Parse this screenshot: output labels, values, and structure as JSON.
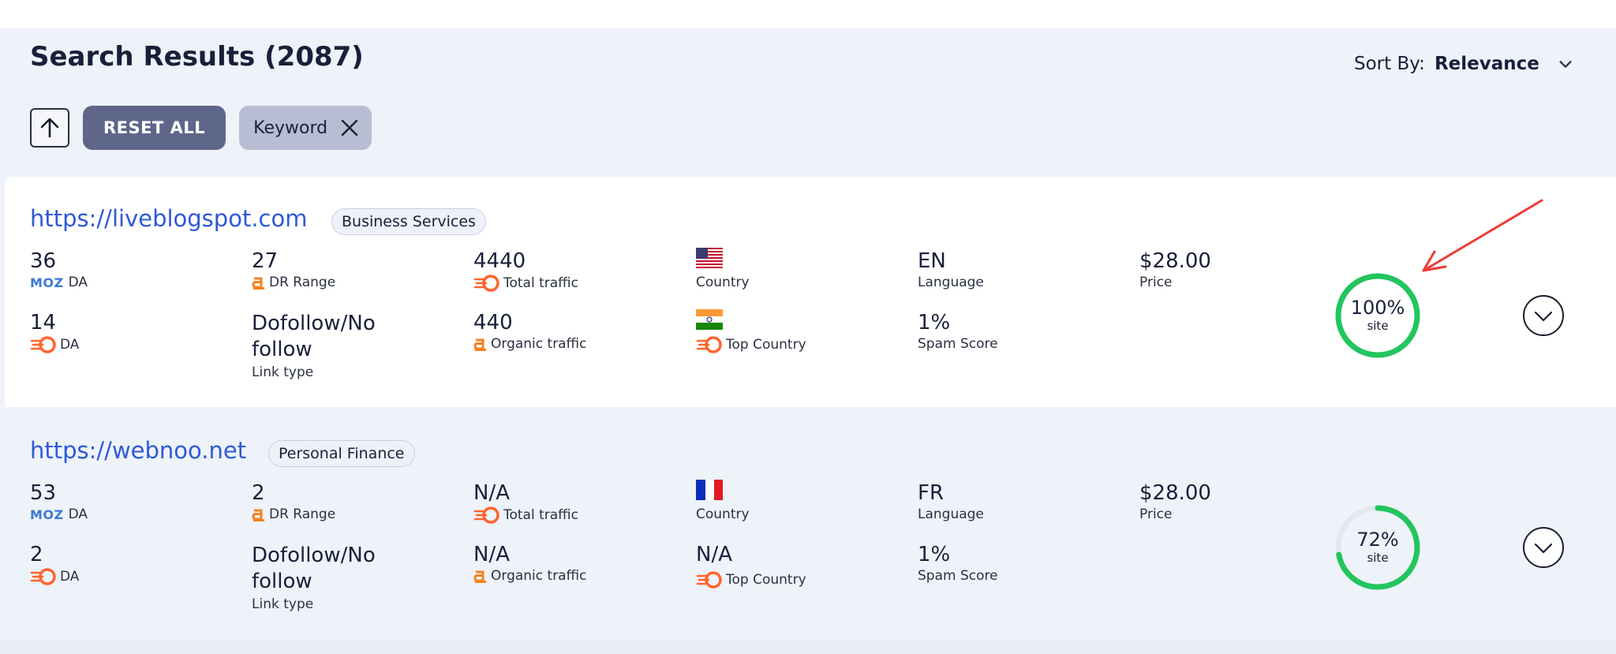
{
  "header": {
    "title": "Search Results (2087)",
    "sort_label": "Sort By:",
    "sort_value": "Relevance",
    "reset_label": "RESET ALL",
    "filter_chip": "Keyword"
  },
  "labels": {
    "moz": "MOZ",
    "da": "DA",
    "dr_range": "DR Range",
    "total_traffic": "Total traffic",
    "organic_traffic": "Organic traffic",
    "country": "Country",
    "top_country": "Top Country",
    "language": "Language",
    "spam_score": "Spam Score",
    "price": "Price",
    "link_type": "Link type",
    "site": "site"
  },
  "results": [
    {
      "url": "https://liveblogspot.com",
      "category": "Business Services",
      "moz_da": "36",
      "dr": "27",
      "total_traffic": "4440",
      "country_flag": "us-flag-icon",
      "language": "EN",
      "price": "$28.00",
      "semrush_da": "14",
      "link_type": "Dofollow/No follow",
      "organic_traffic": "440",
      "top_country_flag": "india-flag-icon",
      "spam_score": "1%",
      "score_percent": "100%",
      "score_value": 100
    },
    {
      "url": "https://webnoo.net",
      "category": "Personal Finance",
      "moz_da": "53",
      "dr": "2",
      "total_traffic": "N/A",
      "country_flag": "france-flag-icon",
      "language": "FR",
      "price": "$28.00",
      "semrush_da": "2",
      "link_type": "Dofollow/No follow",
      "organic_traffic": "N/A",
      "top_country": "N/A",
      "spam_score": "1%",
      "score_percent": "72%",
      "score_value": 72
    }
  ],
  "colors": {
    "link": "#2f58d8",
    "ring_green": "#22c55e",
    "ring_track": "#e4e7ee",
    "annotation_arrow": "#ef3b36",
    "ahrefs_orange": "#f5821f",
    "semrush_orange": "#ff642d"
  }
}
